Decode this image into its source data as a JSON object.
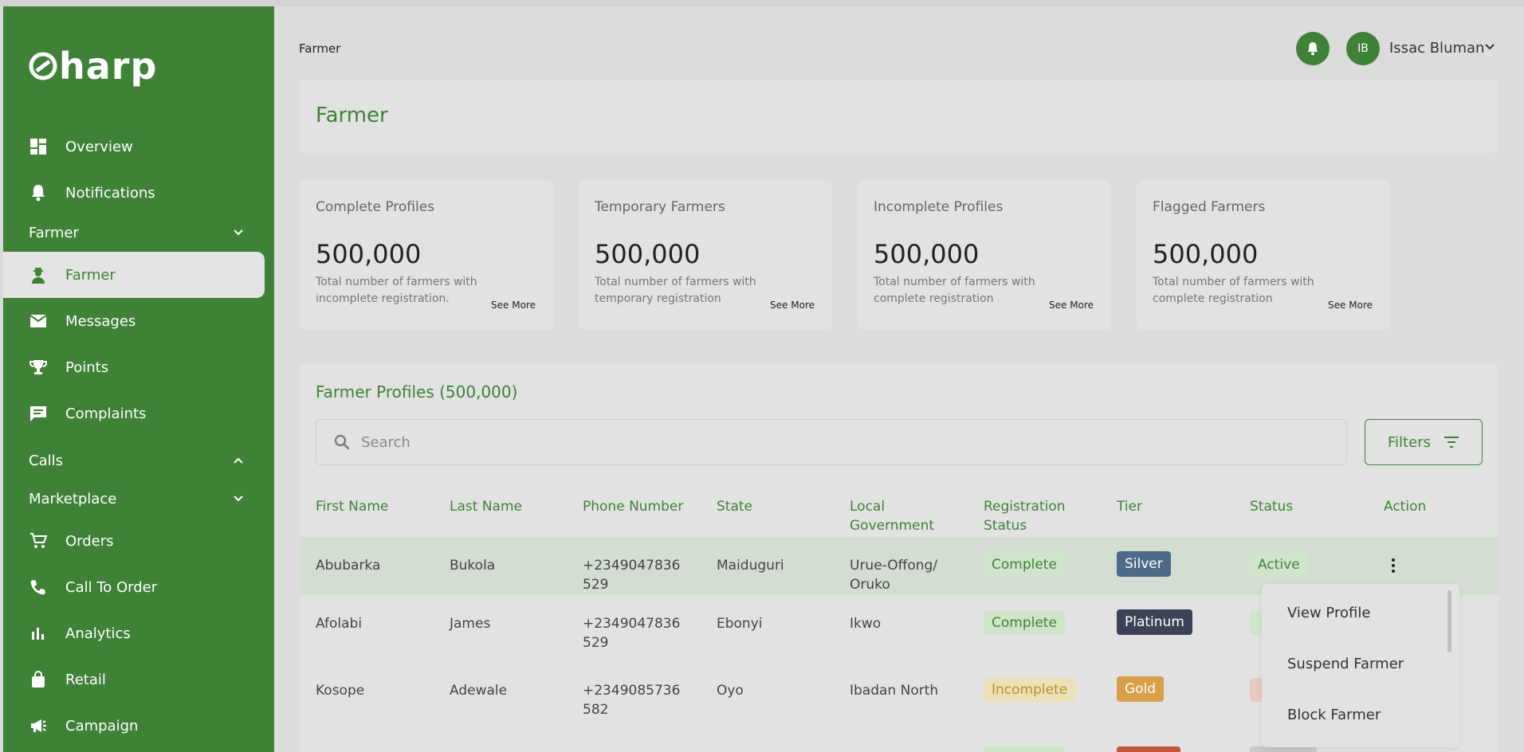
{
  "brand": {
    "logo_text": "harp"
  },
  "sidebar": {
    "items": [
      {
        "label": "Overview",
        "icon": "dashboard-icon"
      },
      {
        "label": "Notifications",
        "icon": "bell-icon"
      }
    ],
    "group_farmer": "Farmer",
    "farmer_item": "Farmer",
    "items2": [
      {
        "label": "Messages",
        "icon": "mail-icon"
      },
      {
        "label": "Points",
        "icon": "trophy-icon"
      },
      {
        "label": "Complaints",
        "icon": "comment-icon"
      }
    ],
    "group_calls": "Calls",
    "group_marketplace": "Marketplace",
    "items3": [
      {
        "label": "Orders",
        "icon": "cart-icon"
      },
      {
        "label": "Call To Order",
        "icon": "phone-icon"
      },
      {
        "label": "Analytics",
        "icon": "bar-chart-icon"
      },
      {
        "label": "Retail",
        "icon": "shopping-bag-icon"
      },
      {
        "label": "Campaign",
        "icon": "megaphone-icon"
      }
    ]
  },
  "header": {
    "breadcrumb": "Farmer",
    "user_initials": "IB",
    "user_name": "Issac Bluman"
  },
  "page": {
    "title": "Farmer"
  },
  "stats": [
    {
      "label": "Complete Profiles",
      "value": "500,000",
      "desc": "Total number of farmers with incomplete registration.",
      "more": "See More"
    },
    {
      "label": "Temporary Farmers",
      "value": "500,000",
      "desc": "Total number of farmers with temporary registration",
      "more": "See More"
    },
    {
      "label": "Incomplete Profiles",
      "value": "500,000",
      "desc": "Total number of farmers with complete registration",
      "more": "See More"
    },
    {
      "label": "Flagged Farmers",
      "value": "500,000",
      "desc": "Total number of farmers with complete registration",
      "more": "See More"
    }
  ],
  "table": {
    "title": "Farmer Profiles (500,000)",
    "search_placeholder": "Search",
    "filters_label": "Filters",
    "columns": {
      "first": "First Name",
      "last": "Last Name",
      "phone": "Phone Number",
      "state": "State",
      "lga_1": "Local",
      "lga_2": "Government",
      "reg_1": "Registration",
      "reg_2": "Status",
      "tier": "Tier",
      "status": "Status",
      "action": "Action"
    },
    "rows": [
      {
        "first": "Abubarka",
        "last": "Bukola",
        "phone_1": "+2349047836",
        "phone_2": "529",
        "state": "Maiduguri",
        "lga_1": "Urue-Offong/",
        "lga_2": "Oruko",
        "reg": "Complete",
        "tier": "Silver",
        "status": "Active"
      },
      {
        "first": "Afolabi",
        "last": "James",
        "phone_1": "+2349047836",
        "phone_2": "529",
        "state": "Ebonyi",
        "lga_1": "Ikwo",
        "lga_2": "",
        "reg": "Complete",
        "tier": "Platinum",
        "status": ""
      },
      {
        "first": "Kosope",
        "last": "Adewale",
        "phone_1": "+2349085736",
        "phone_2": "582",
        "state": "Oyo",
        "lga_1": "Ibadan North",
        "lga_2": "",
        "reg": "Incomplete",
        "tier": "Gold",
        "status": ""
      }
    ]
  },
  "row_menu": {
    "items": [
      "View Profile",
      "Suspend Farmer",
      "Block Farmer"
    ]
  },
  "colors": {
    "primary": "#3f8137",
    "tier_silver": "#4d6a8a",
    "tier_platinum": "#3d4356",
    "tier_gold": "#d9a04a"
  }
}
